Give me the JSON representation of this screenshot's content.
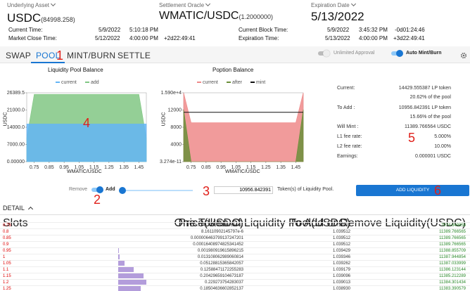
{
  "header": {
    "underlying_label": "Underlying Asset",
    "underlying_value": "USDC",
    "underlying_sub": "(84998.258)",
    "oracle_label": "Settlement Oracle",
    "oracle_value": "WMATIC/USDC",
    "oracle_sub": "(1.2000000)",
    "expiration_label": "Expiration Date",
    "expiration_value": "5/13/2022",
    "current_time_label": "Current Time:",
    "current_time_date": "5/9/2022",
    "current_time_clock": "5:10:18 PM",
    "market_close_label": "Market Close Time:",
    "market_close_date": "5/12/2022",
    "market_close_clock": "4:00:00 PM",
    "market_close_delta": "+2d22:49:41",
    "block_time_label": "Current Block Time:",
    "block_time_date": "5/9/2022",
    "block_time_clock": "3:45:32 PM",
    "block_time_delta": "-0d01:24:46",
    "expiration_time_label": "Expiration Time:",
    "expiration_time_date": "5/13/2022",
    "expiration_time_clock": "4:00:00 PM",
    "expiration_time_delta": "+3d22:49:41"
  },
  "tabs": [
    "SWAP",
    "POOL",
    "MINT/BURN",
    "SETTLE"
  ],
  "active_tab": "POOL",
  "toggles": {
    "unlimited_approval": "Unlimited Approval",
    "auto_mint_burn": "Auto Mint/Burn"
  },
  "charts": {
    "pool_title": "Liquidity Pool Balance",
    "pool_legend": [
      "current",
      "add"
    ],
    "pool_ylabel": "USDC",
    "pool_xlabel": "WMATIC/USDC",
    "pool_yticks": [
      "26389.5",
      "21000.0",
      "14000.0",
      "7000.00",
      "0.00000"
    ],
    "poption_title": "Poption Balance",
    "poption_legend": [
      "current",
      "after",
      "mint"
    ],
    "poption_ylabel": "USDC",
    "poption_xlabel": "WMATIC/USDC",
    "poption_yticks": [
      "1.590e+4",
      "12000",
      "8000",
      "4000",
      "3.274e-11"
    ],
    "xticks": [
      "0.75",
      "0.85",
      "0.95",
      "1.05",
      "1.15",
      "1.25",
      "1.35",
      "1.45"
    ]
  },
  "chart_data": [
    {
      "type": "area",
      "title": "Liquidity Pool Balance",
      "xlabel": "WMATIC/USDC",
      "ylabel": "USDC",
      "ylim": [
        0,
        26389.5
      ],
      "x": [
        0.7,
        0.75,
        0.85,
        0.95,
        1.05,
        1.15,
        1.25,
        1.35,
        1.45,
        1.5
      ],
      "series": [
        {
          "name": "current",
          "values": [
            14429,
            14429,
            14429,
            14429,
            14429,
            14429,
            14429,
            14429,
            14429,
            14429
          ]
        },
        {
          "name": "add",
          "values": [
            9000,
            25819,
            25819,
            25819,
            25819,
            25819,
            25819,
            25819,
            25819,
            9000
          ]
        }
      ],
      "legend": "top-center"
    },
    {
      "type": "area",
      "title": "Poption Balance",
      "xlabel": "WMATIC/USDC",
      "ylabel": "USDC",
      "ylim": [
        0,
        15900
      ],
      "x": [
        0.7,
        0.75,
        0.85,
        0.95,
        1.05,
        1.15,
        1.25,
        1.35,
        1.45,
        1.5
      ],
      "series": [
        {
          "name": "current",
          "values": [
            15900,
            9000,
            9000,
            9000,
            9000,
            9000,
            9000,
            9000,
            9000,
            15900
          ]
        },
        {
          "name": "after",
          "values": [
            12000,
            0,
            0,
            0,
            0,
            0,
            0,
            0,
            0,
            12000
          ]
        },
        {
          "name": "mint",
          "values": [
            11389.8,
            11389.8,
            11389.8,
            11389.8,
            11389.8,
            11389.8,
            11389.8,
            11389.8,
            11389.8,
            11389.8
          ]
        }
      ],
      "legend": "top-center"
    }
  ],
  "info": {
    "current_label": "Current:",
    "current_value": "14429.555387 LP token",
    "current_pct": "20.62% of the pool",
    "toadd_label": "To Add :",
    "toadd_value": "10956.842391 LP token",
    "toadd_pct": "15.66% of the pool",
    "will_mint_label": "Will Mint :",
    "will_mint_value": "11389.766564 USDC",
    "l1_label": "L1 fee rate:",
    "l1_value": "5.000%",
    "l2_label": "L2 fee rate:",
    "l2_value": "10.00%",
    "earnings_label": "Earnings:",
    "earnings_value": "0.000001 USDC"
  },
  "controls": {
    "remove_label": "Remove",
    "add_label": "Add",
    "amount_value": "10956.842391",
    "amount_unit": "Token(s) of Liquidity Pool.",
    "add_button": "ADD LIQUIDITY",
    "slider_percent": 4
  },
  "detail": {
    "title": "DETAIL",
    "columns": [
      "Slots",
      "Price(USDC)",
      "One Token of Liquidity Pool(USDC)",
      "To Add or Remove Liquidity(USDC)"
    ],
    "rows": [
      [
        "0.75",
        "3.7341723506106965e-11",
        "0.727823",
        "7974.649858"
      ],
      [
        "0.8",
        "8.16110902145797e-6",
        "1.039512",
        "11389.766565"
      ],
      [
        "0.85",
        "0.000006463799137247201",
        "1.039512",
        "11389.766565"
      ],
      [
        "0.9",
        "0.00016408974825341452",
        "1.039512",
        "11389.766565"
      ],
      [
        "0.95",
        "0.001980919615896215",
        "1.039429",
        "11388.855709"
      ],
      [
        "1",
        "0.013108062989060814",
        "1.039346",
        "11387.944854"
      ],
      [
        "1.05",
        "0.05128815365842057",
        "1.039262",
        "11387.033999"
      ],
      [
        "1.1",
        "0.12588471172255283",
        "1.039179",
        "11386.123144"
      ],
      [
        "1.15",
        "0.20429659104673187",
        "1.039096",
        "11385.212289"
      ],
      [
        "1.2",
        "0.229273754283037",
        "1.039013",
        "11384.301434"
      ],
      [
        "1.25",
        "0.18504636602852137",
        "1.038930",
        "11383.390579"
      ]
    ],
    "bar_values": [
      0,
      0,
      0,
      0,
      0.002,
      0.013,
      0.051,
      0.126,
      0.204,
      0.229,
      0.185
    ]
  },
  "annotations": [
    "1",
    "2",
    "3",
    "4",
    "5",
    "6"
  ],
  "colors": {
    "accent": "#1976d2",
    "pool_current": "#64b5f6",
    "pool_add": "#81c784",
    "poption_current": "#ef8a8a",
    "poption_after": "#6b8f3a",
    "mint": "#111111",
    "annotation": "#e0201a",
    "bars": "#b39ddb"
  }
}
